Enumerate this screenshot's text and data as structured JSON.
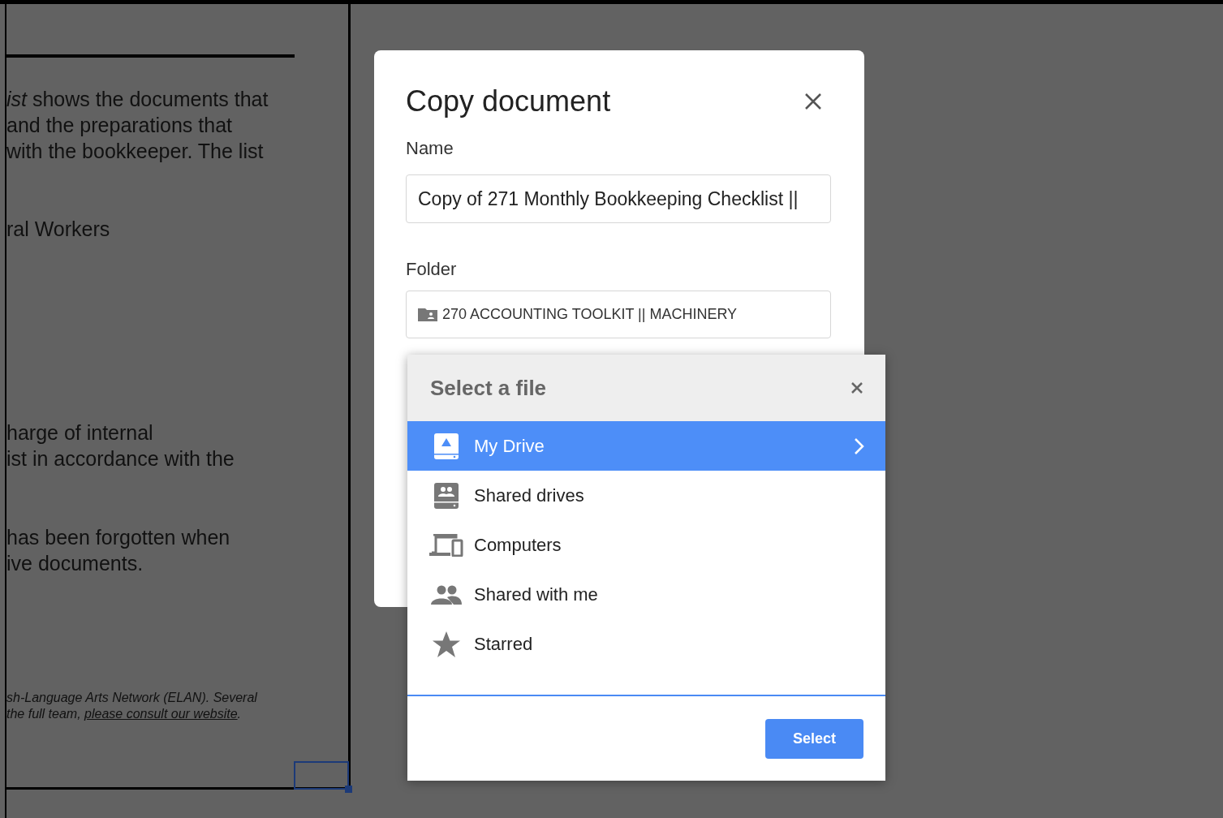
{
  "document": {
    "paragraphs": [
      [
        "*ist* shows the documents that",
        "and the preparations that",
        "with the bookkeeper. The list"
      ],
      [
        "ral Workers"
      ],
      [
        "harge of internal",
        "ist in accordance with the"
      ],
      [
        "has been forgotten when",
        "ive documents."
      ]
    ],
    "footnote": {
      "line_1": "sh-Language Arts Network (ELAN). Several",
      "line_2_start": "the full team, ",
      "link": "please consult our website",
      "line_2_end": "."
    }
  },
  "dialog": {
    "title": "Copy document",
    "name_label": "Name",
    "name_value": "Copy of 271 Monthly Bookkeeping Checklist ||",
    "folder_label": "Folder",
    "folder_value": "270 ACCOUNTING TOOLKIT || MACHINERY"
  },
  "picker": {
    "title": "Select a file",
    "items": [
      {
        "label": "My Drive",
        "kind": "drive",
        "selected": true
      },
      {
        "label": "Shared drives",
        "kind": "shared-drive",
        "selected": false
      },
      {
        "label": "Computers",
        "kind": "computers",
        "selected": false
      },
      {
        "label": "Shared with me",
        "kind": "people",
        "selected": false
      },
      {
        "label": "Starred",
        "kind": "star",
        "selected": false
      }
    ],
    "select_button": "Select"
  }
}
